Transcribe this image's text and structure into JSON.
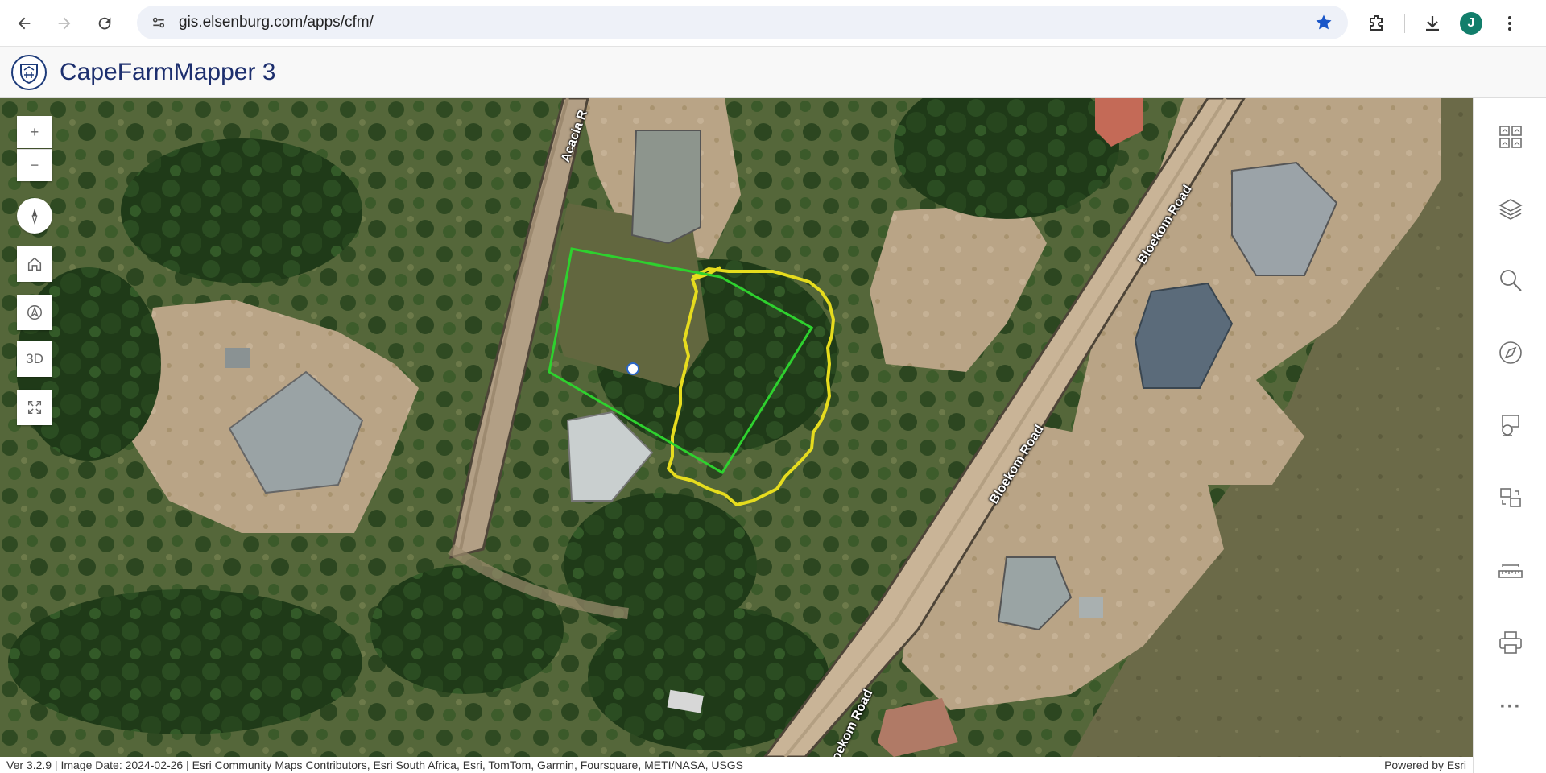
{
  "browser": {
    "url": "gis.elsenburg.com/apps/cfm/",
    "profile_initial": "J"
  },
  "app": {
    "title": "CapeFarmMapper 3"
  },
  "map_controls": {
    "zoom_in": "+",
    "zoom_out": "−",
    "three_d": "3D"
  },
  "road_labels": {
    "acacia": "Acacia R",
    "bloekom_top": "Bloekom Road",
    "bloekom_mid": "Bloekom Road",
    "bloekom_bottom": "oekom Road"
  },
  "side_panel": {
    "more": "···"
  },
  "attribution": {
    "left": "Ver 3.2.9 | Image Date: 2024-02-26 | Esri Community Maps Contributors, Esri South Africa, Esri, TomTom, Garmin, Foursquare, METI/NASA, USGS",
    "right": "Powered by Esri"
  },
  "colors": {
    "parcel_green": "#2ed12e",
    "boundary_yellow": "#e6dc1e",
    "title_blue": "#1d2f6e"
  }
}
